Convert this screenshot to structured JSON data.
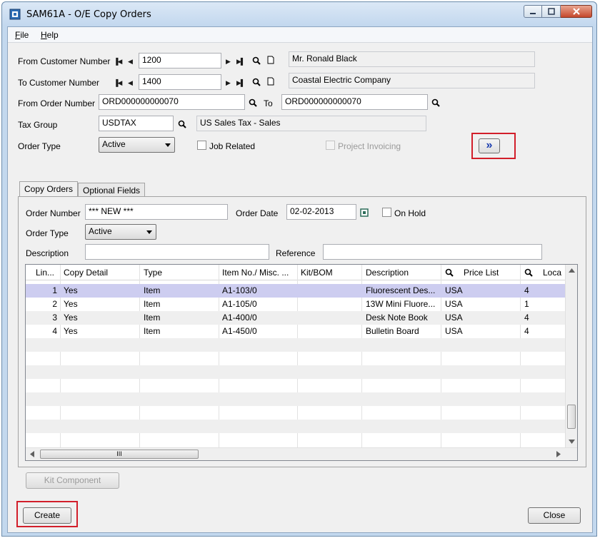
{
  "window": {
    "title": "SAM61A - O/E Copy Orders"
  },
  "menu": {
    "file_pre": "",
    "file_u": "F",
    "file_rest": "ile",
    "help_u": "H",
    "help_rest": "elp"
  },
  "header": {
    "from_customer_label": "From Customer Number",
    "from_customer_value": "1200",
    "from_customer_name": "Mr. Ronald Black",
    "to_customer_label": "To Customer Number",
    "to_customer_value": "1400",
    "to_customer_name": "Coastal Electric Company",
    "from_order_label": "From Order Number",
    "from_order_value": "ORD000000000070",
    "to_label": "To",
    "to_order_value": "ORD000000000070",
    "tax_group_label": "Tax Group",
    "tax_group_value": "USDTAX",
    "tax_group_desc": "US Sales Tax - Sales",
    "order_type_label": "Order Type",
    "order_type_value": "Active",
    "job_related_label": "Job Related",
    "project_invoicing_label": "Project Invoicing",
    "expand_button_label": "»"
  },
  "tabs": [
    {
      "label": "Copy Orders"
    },
    {
      "label": "Optional Fields"
    }
  ],
  "copy_orders": {
    "order_number_label": "Order Number",
    "order_number_value": "*** NEW ***",
    "order_date_label": "Order Date",
    "order_date_value": "02-02-2013",
    "on_hold_label": "On Hold",
    "order_type_label": "Order Type",
    "order_type_value": "Active",
    "description_label": "Description",
    "description_value": "",
    "reference_label": "Reference",
    "reference_value": ""
  },
  "grid": {
    "columns": [
      "Lin...",
      "Copy Detail",
      "Type",
      "Item No./ Misc. ...",
      "Kit/BOM",
      "Description",
      "Price List",
      "Loca"
    ],
    "rows": [
      {
        "line": "1",
        "copy": "Yes",
        "type": "Item",
        "item": "A1-103/0",
        "kit": "",
        "desc": "Fluorescent Des...",
        "price": "USA",
        "loc": "4"
      },
      {
        "line": "2",
        "copy": "Yes",
        "type": "Item",
        "item": "A1-105/0",
        "kit": "",
        "desc": "13W Mini Fluore...",
        "price": "USA",
        "loc": "1"
      },
      {
        "line": "3",
        "copy": "Yes",
        "type": "Item",
        "item": "A1-400/0",
        "kit": "",
        "desc": "Desk Note Book",
        "price": "USA",
        "loc": "4"
      },
      {
        "line": "4",
        "copy": "Yes",
        "type": "Item",
        "item": "A1-450/0",
        "kit": "",
        "desc": "Bulletin Board",
        "price": "USA",
        "loc": "4"
      }
    ],
    "hscroll_grip": "III"
  },
  "buttons": {
    "kit_component": "Kit Component",
    "create": "Create",
    "close": "Close"
  },
  "colors": {
    "highlight": "#d21e2a",
    "selected_row": "#cdcdf0"
  }
}
